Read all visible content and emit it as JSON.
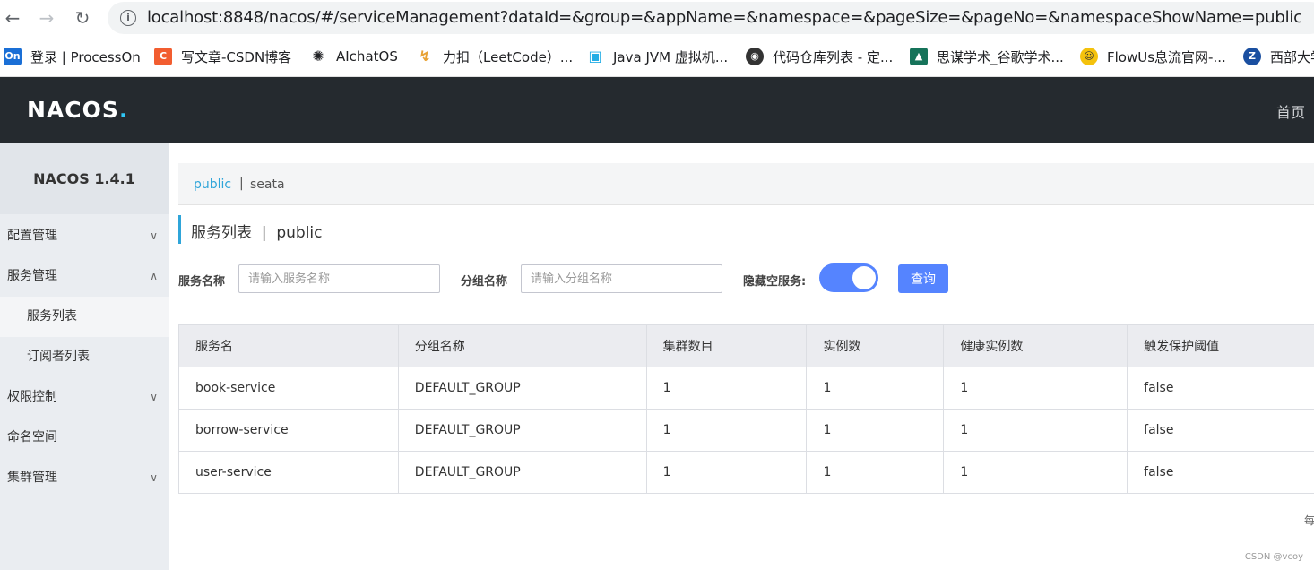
{
  "browser": {
    "url": "localhost:8848/nacos/#/serviceManagement?dataId=&group=&appName=&namespace=&pageSize=&pageNo=&namespaceShowName=public",
    "bookmarks": [
      {
        "label": "登录 | ProcessOn",
        "icon": "On",
        "color": "#1a6fd6"
      },
      {
        "label": "写文章-CSDN博客",
        "icon": "C",
        "color": "#f25d30"
      },
      {
        "label": "AIchatOS",
        "icon": "✺",
        "color": "#202124"
      },
      {
        "label": "力扣（LeetCode）...",
        "icon": "↯",
        "color": "#e8a234"
      },
      {
        "label": "Java JVM 虚拟机...",
        "icon": "▣",
        "color": "#23ade5"
      },
      {
        "label": "代码仓库列表 - 定...",
        "icon": "◉",
        "color": "#333333"
      },
      {
        "label": "思谋学术_谷歌学术...",
        "icon": "▲",
        "color": "#16735a"
      },
      {
        "label": "FlowUs息流官网-...",
        "icon": "☺",
        "color": "#f4c20d"
      },
      {
        "label": "西部大学",
        "icon": "Z",
        "color": "#1a4fa0"
      }
    ]
  },
  "header": {
    "logo_main": "NACOS",
    "logo_dot": ".",
    "home_label": "首页"
  },
  "sidebar": {
    "version": "NACOS 1.4.1",
    "items": [
      {
        "label": "配置管理",
        "chevron": "∨"
      },
      {
        "label": "服务管理",
        "chevron": "∧"
      },
      {
        "label": "服务列表"
      },
      {
        "label": "订阅者列表"
      },
      {
        "label": "权限控制",
        "chevron": "∨"
      },
      {
        "label": "命名空间"
      },
      {
        "label": "集群管理",
        "chevron": "∨"
      }
    ]
  },
  "namespaces": {
    "active": "public",
    "separator": "|",
    "other": "seata"
  },
  "page_title": "服务列表  |  public",
  "filters": {
    "service_name_label": "服务名称",
    "service_name_placeholder": "请输入服务名称",
    "group_name_label": "分组名称",
    "group_name_placeholder": "请输入分组名称",
    "hide_empty_label": "隐藏空服务:",
    "hide_empty_on": true,
    "query_label": "查询"
  },
  "table": {
    "columns": [
      "服务名",
      "分组名称",
      "集群数目",
      "实例数",
      "健康实例数",
      "触发保护阈值"
    ],
    "rows": [
      [
        "book-service",
        "DEFAULT_GROUP",
        "1",
        "1",
        "1",
        "false"
      ],
      [
        "borrow-service",
        "DEFAULT_GROUP",
        "1",
        "1",
        "1",
        "false"
      ],
      [
        "user-service",
        "DEFAULT_GROUP",
        "1",
        "1",
        "1",
        "false"
      ]
    ]
  },
  "pager_hint": "每",
  "watermark": "CSDN @vcoy"
}
